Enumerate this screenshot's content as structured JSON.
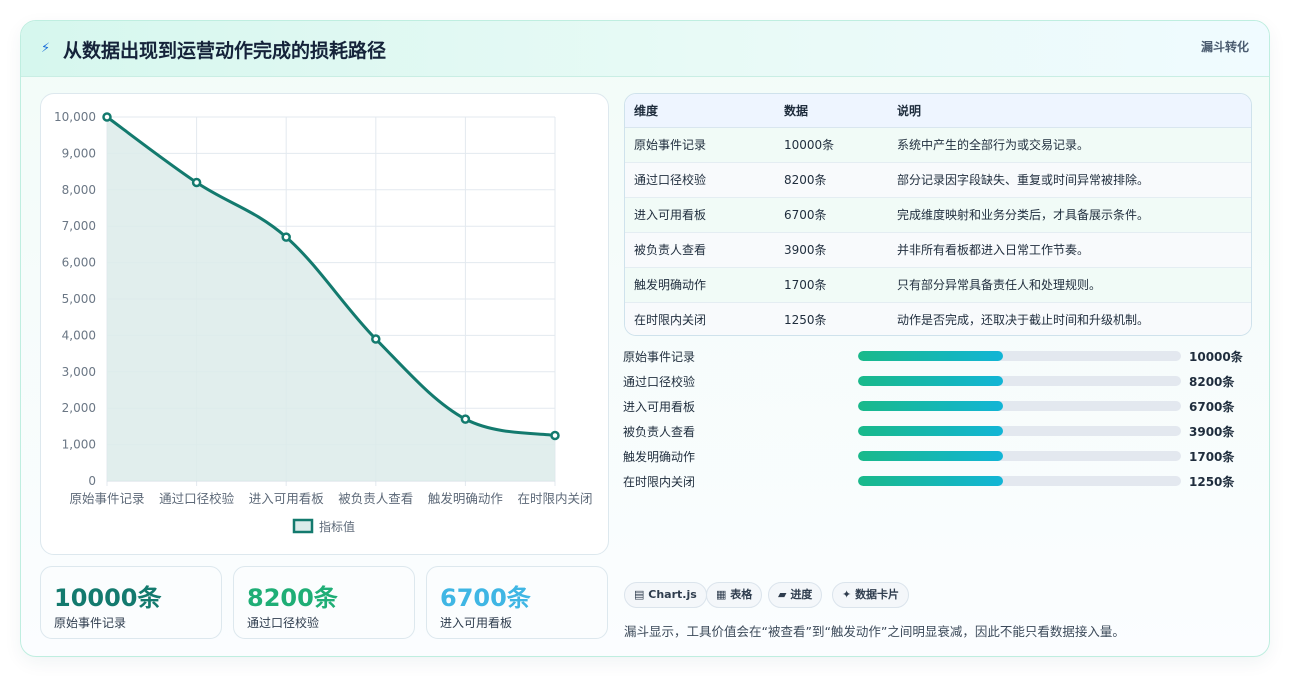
{
  "header": {
    "title": "从数据出现到运营动作完成的损耗路径",
    "badge": "漏斗转化"
  },
  "chart_data": {
    "type": "line",
    "categories": [
      "原始事件记录",
      "通过口径校验",
      "进入可用看板",
      "被负责人查看",
      "触发明确动作",
      "在时限内关闭"
    ],
    "series": [
      {
        "name": "指标值",
        "values": [
          10000,
          8200,
          6700,
          3900,
          1700,
          1250
        ],
        "color": "#137a6e",
        "fill": "#dcebea"
      }
    ],
    "ylim": [
      0,
      10000
    ],
    "yticks": [
      "0",
      "1,000",
      "2,000",
      "3,000",
      "4,000",
      "5,000",
      "6,000",
      "7,000",
      "8,000",
      "9,000",
      "10,000"
    ],
    "grid": true,
    "legend": "bottom"
  },
  "stats": [
    {
      "value": "10000条",
      "label": "原始事件记录",
      "color": "#137a6e"
    },
    {
      "value": "8200条",
      "label": "通过口径校验",
      "color": "#1fae76"
    },
    {
      "value": "6700条",
      "label": "进入可用看板",
      "color": "#3fb6e4"
    }
  ],
  "table": {
    "headers": [
      "维度",
      "数据",
      "说明"
    ],
    "rows": [
      [
        "原始事件记录",
        "10000条",
        "系统中产生的全部行为或交易记录。"
      ],
      [
        "通过口径校验",
        "8200条",
        "部分记录因字段缺失、重复或时间异常被排除。"
      ],
      [
        "进入可用看板",
        "6700条",
        "完成维度映射和业务分类后，才具备展示条件。"
      ],
      [
        "被负责人查看",
        "3900条",
        "并非所有看板都进入日常工作节奏。"
      ],
      [
        "触发明确动作",
        "1700条",
        "只有部分异常具备责任人和处理规则。"
      ],
      [
        "在时限内关闭",
        "1250条",
        "动作是否完成，还取决于截止时间和升级机制。"
      ]
    ]
  },
  "progress": [
    {
      "label": "原始事件记录",
      "value": "10000条",
      "fill": 0.45
    },
    {
      "label": "通过口径校验",
      "value": "8200条",
      "fill": 0.45
    },
    {
      "label": "进入可用看板",
      "value": "6700条",
      "fill": 0.45
    },
    {
      "label": "被负责人查看",
      "value": "3900条",
      "fill": 0.45
    },
    {
      "label": "触发明确动作",
      "value": "1700条",
      "fill": 0.45
    },
    {
      "label": "在时限内关闭",
      "value": "1250条",
      "fill": 0.45
    }
  ],
  "chips": [
    {
      "icon": "▤",
      "label": "Chart.js"
    },
    {
      "icon": "▦",
      "label": "表格"
    },
    {
      "icon": "▰",
      "label": "进度"
    },
    {
      "icon": "✦",
      "label": "数据卡片"
    }
  ],
  "note": "漏斗显示，工具价值会在“被查看”到“触发动作”之间明显衰减，因此不能只看数据接入量。"
}
